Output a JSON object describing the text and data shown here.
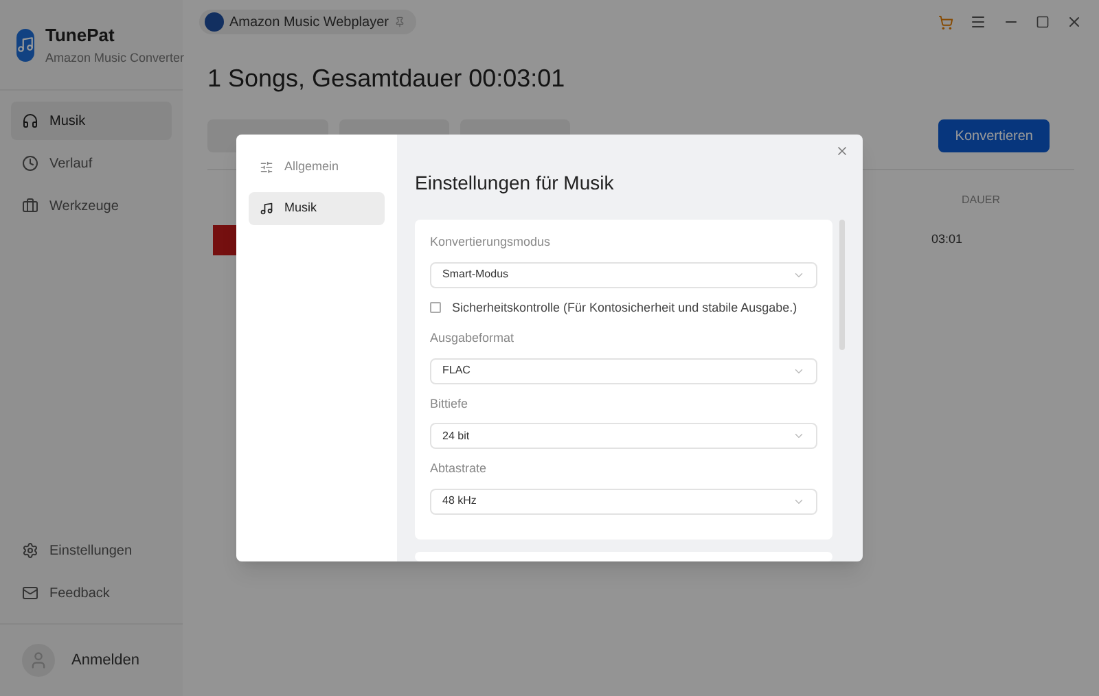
{
  "app": {
    "name": "TunePat",
    "subtitle": "Amazon Music Converter"
  },
  "sidebar": {
    "items": [
      {
        "label": "Musik",
        "selected": true
      },
      {
        "label": "Verlauf",
        "selected": false
      },
      {
        "label": "Werkzeuge",
        "selected": false
      }
    ],
    "bottom_items": [
      {
        "label": "Einstellungen"
      },
      {
        "label": "Feedback"
      }
    ],
    "account": {
      "label": "Anmelden"
    }
  },
  "source_tab": {
    "label": "Amazon Music Webplayer"
  },
  "heading": "1 Songs, Gesamtdauer 00:03:01",
  "convert_button": "Konvertieren",
  "table": {
    "columns": [
      "DAUER"
    ],
    "rows": [
      {
        "duration": "03:01"
      }
    ]
  },
  "dialog": {
    "nav": [
      {
        "label": "Allgemein",
        "selected": false
      },
      {
        "label": "Musik",
        "selected": true
      }
    ],
    "title": "Einstellungen für Musik",
    "fields": [
      {
        "kind": "select",
        "label": "Konvertierungsmodus",
        "value": "Smart-Modus"
      },
      {
        "kind": "checkbox",
        "label": "Sicherheitskontrolle (Für Kontosicherheit und stabile Ausgabe.)",
        "checked": false
      },
      {
        "kind": "select",
        "label": "Ausgabeformat",
        "value": "FLAC"
      },
      {
        "kind": "select",
        "label": "Bittiefe",
        "value": "24 bit"
      },
      {
        "kind": "select",
        "label": "Abtastrate",
        "value": "48 kHz"
      }
    ]
  }
}
